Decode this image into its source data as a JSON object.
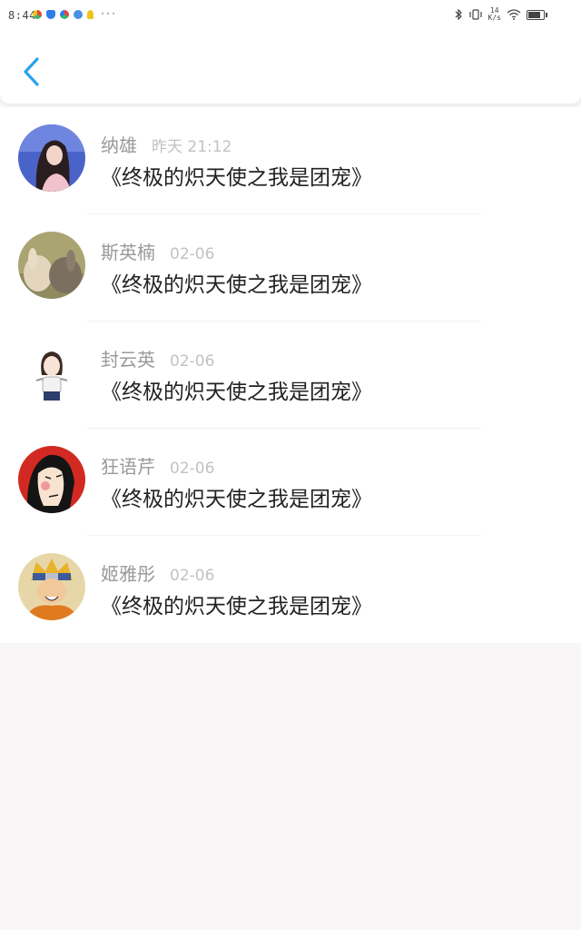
{
  "status_bar": {
    "time": "8:44",
    "dots": "···",
    "net_speed_value": "14",
    "net_speed_unit": "K/s",
    "left_icon_colors": [
      "#e8463c",
      "#2f7ee8",
      "#3cb371",
      "#4a90e2",
      "#f0c419"
    ]
  },
  "header": {
    "back_icon": "chevron-left-icon",
    "accent_color": "#2aa1ef"
  },
  "comments": [
    {
      "name": "纳雄",
      "time": "昨天 21:12",
      "text": "《终极的炽天使之我是团宠》",
      "avatar": "girl-dark-hair"
    },
    {
      "name": "斯英楠",
      "time": "02-06",
      "text": "《终极的炽天使之我是团宠》",
      "avatar": "two-rabbits"
    },
    {
      "name": "封云英",
      "time": "02-06",
      "text": "《终极的炽天使之我是团宠》",
      "avatar": "cartoon-girl"
    },
    {
      "name": "狂语芹",
      "time": "02-06",
      "text": "《终极的炽天使之我是团宠》",
      "avatar": "cartoon-face-red"
    },
    {
      "name": "姬雅彤",
      "time": "02-06",
      "text": "《终极的炽天使之我是团宠》",
      "avatar": "anime-ninja"
    }
  ]
}
